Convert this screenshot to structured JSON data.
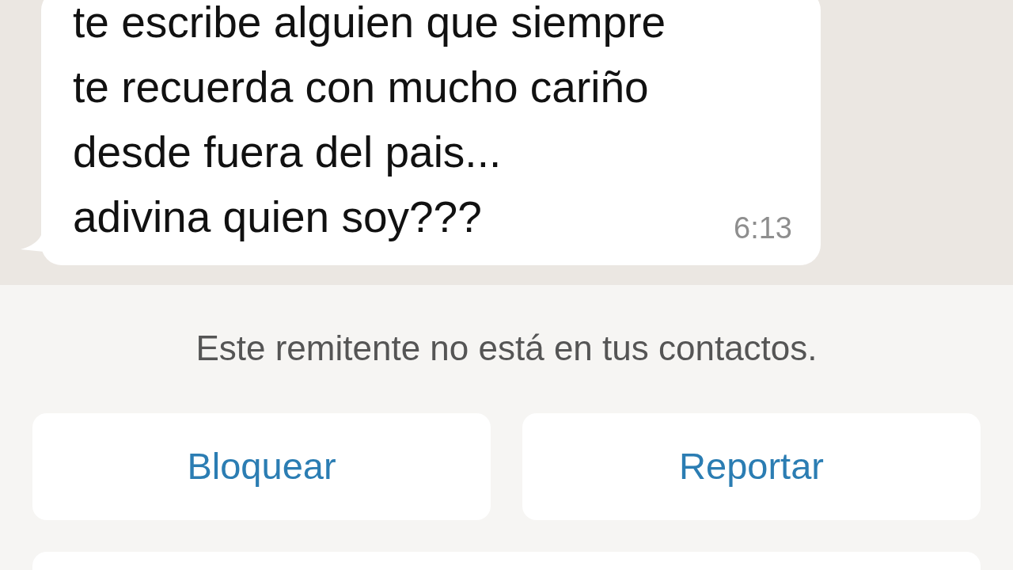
{
  "message": {
    "lines": [
      "te escribe alguien que siempre",
      "te recuerda con mucho cariño",
      "desde fuera del pais...",
      "adivina quien soy???"
    ],
    "time": "6:13"
  },
  "unknown_sender_notice": "Este remitente no está en tus contactos.",
  "buttons": [
    "Bloquear",
    "Reportar"
  ]
}
